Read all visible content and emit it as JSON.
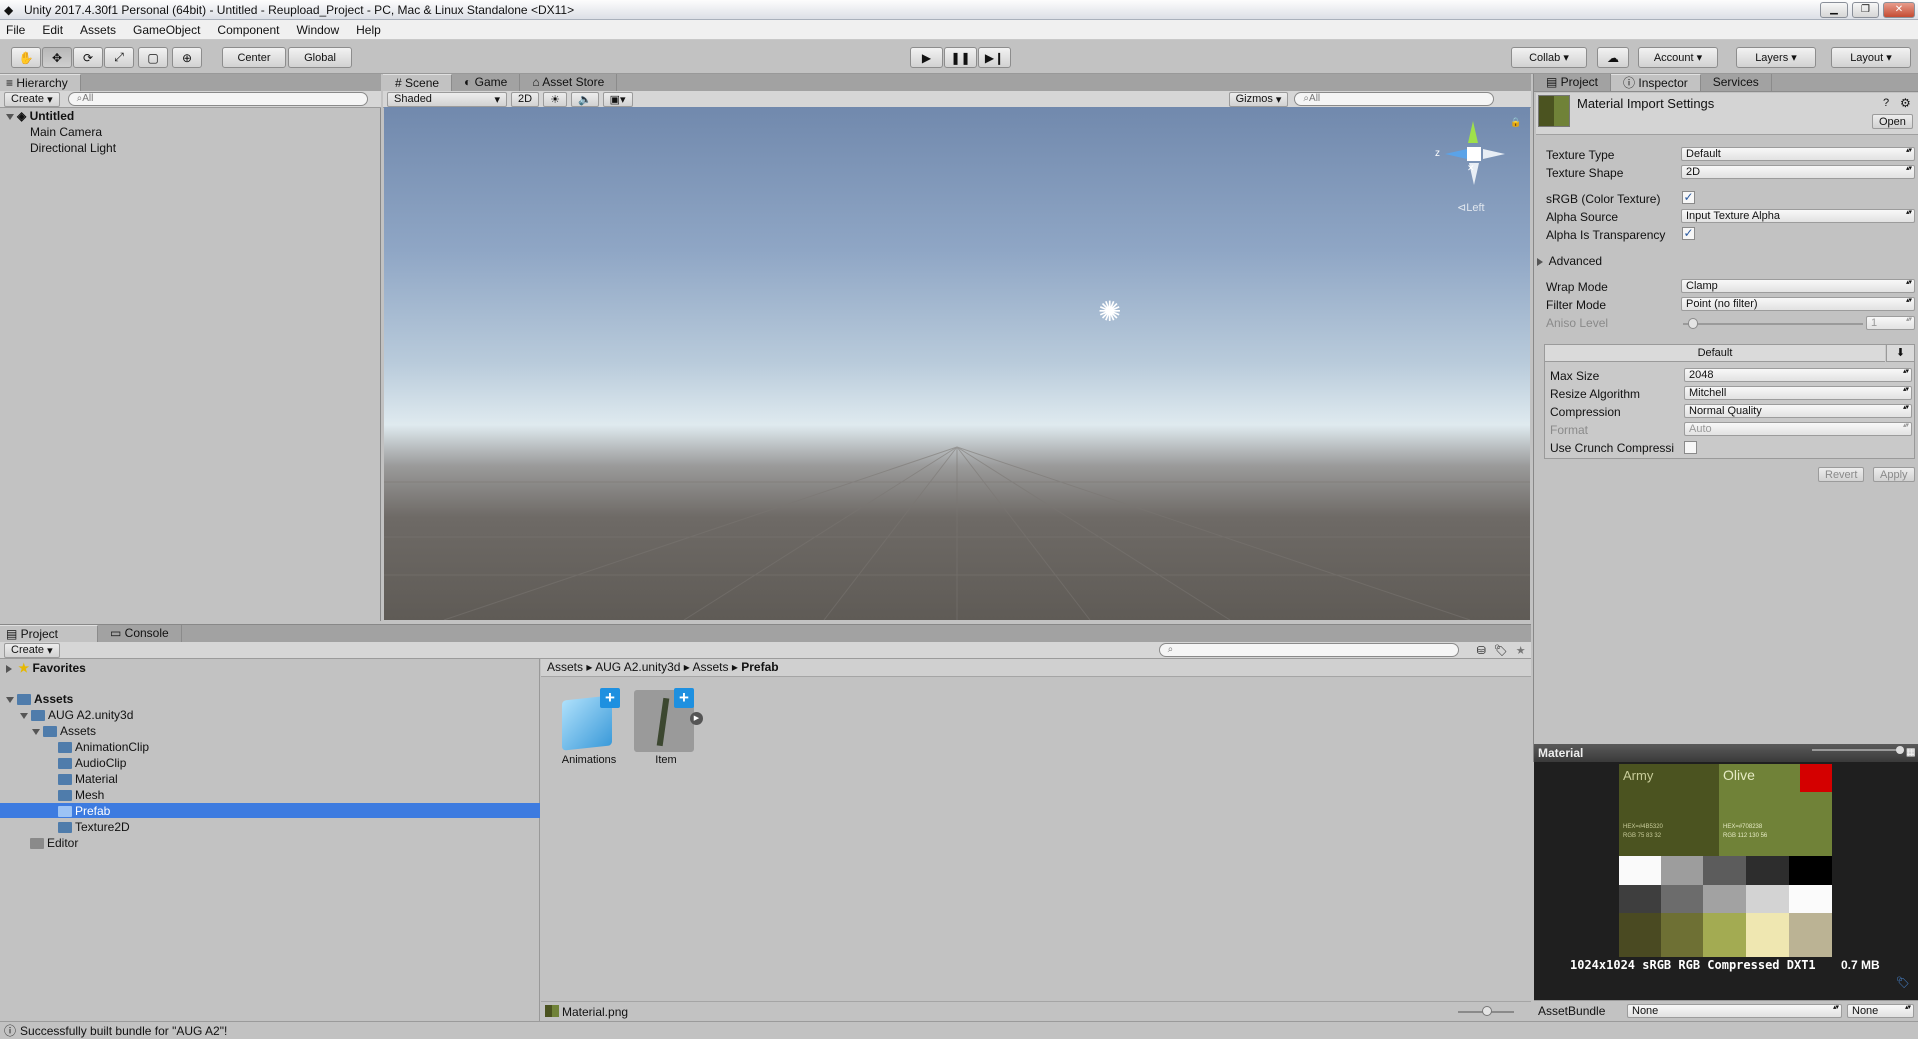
{
  "window": {
    "title": "Unity 2017.4.30f1 Personal (64bit) - Untitled - Reupload_Project - PC, Mac & Linux Standalone <DX11>"
  },
  "menu": [
    "File",
    "Edit",
    "Assets",
    "GameObject",
    "Component",
    "Window",
    "Help"
  ],
  "toolbar": {
    "pivot": "Center",
    "space": "Global",
    "collab": "Collab",
    "account": "Account",
    "layers": "Layers",
    "layout": "Layout"
  },
  "hierarchy": {
    "tab": "Hierarchy",
    "create": "Create",
    "search_placeholder": "All",
    "scene": "Untitled",
    "items": [
      "Main Camera",
      "Directional Light"
    ]
  },
  "scene_tabs": {
    "scene": "Scene",
    "game": "Game",
    "asset_store": "Asset Store",
    "shading": "Shaded",
    "mode_2d": "2D",
    "gizmos": "Gizmos",
    "search_placeholder": "All",
    "gizmo_label": "Left",
    "gizmo_z": "z"
  },
  "inspector": {
    "tabs": [
      "Project",
      "Inspector",
      "Services"
    ],
    "title": "Material Import Settings",
    "open": "Open",
    "texture_type_label": "Texture Type",
    "texture_type": "Default",
    "texture_shape_label": "Texture Shape",
    "texture_shape": "2D",
    "srgb_label": "sRGB (Color Texture)",
    "alpha_source_label": "Alpha Source",
    "alpha_source": "Input Texture Alpha",
    "alpha_transparency_label": "Alpha Is Transparency",
    "advanced": "Advanced",
    "wrap_mode_label": "Wrap Mode",
    "wrap_mode": "Clamp",
    "filter_mode_label": "Filter Mode",
    "filter_mode": "Point (no filter)",
    "aniso_label": "Aniso Level",
    "aniso_value": "1",
    "platform_tab": "Default",
    "max_size_label": "Max Size",
    "max_size": "2048",
    "resize_label": "Resize Algorithm",
    "resize": "Mitchell",
    "compression_label": "Compression",
    "compression": "Normal Quality",
    "format_label": "Format",
    "format": "Auto",
    "crunch_label": "Use Crunch Compressi",
    "revert": "Revert",
    "apply": "Apply"
  },
  "preview": {
    "header": "Material",
    "swatch_army": "Army",
    "swatch_olive": "Olive",
    "army_hex": "HEX=#4B5320",
    "army_rgb": "RGB 75 83 32",
    "olive_hex": "HEX=#708238",
    "olive_rgb": "RGB 112 130 56",
    "info": "1024x1024 sRGB  RGB Compressed DXT1",
    "size": "0.7 MB",
    "assetbundle_label": "AssetBundle",
    "assetbundle_value": "None",
    "variant_value": "None"
  },
  "project": {
    "tabs": [
      "Project",
      "Console"
    ],
    "create": "Create",
    "favorites": "Favorites",
    "assets_root": "Assets",
    "tree": [
      {
        "label": "AUG A2.unity3d",
        "depth": 1
      },
      {
        "label": "Assets",
        "depth": 2
      },
      {
        "label": "AnimationClip",
        "depth": 3
      },
      {
        "label": "AudioClip",
        "depth": 3
      },
      {
        "label": "Material",
        "depth": 3
      },
      {
        "label": "Mesh",
        "depth": 3
      },
      {
        "label": "Prefab",
        "depth": 3,
        "selected": true
      },
      {
        "label": "Texture2D",
        "depth": 3
      },
      {
        "label": "Editor",
        "depth": 1
      }
    ],
    "breadcrumb": [
      "Assets",
      "AUG A2.unity3d",
      "Assets",
      "Prefab"
    ],
    "grid_items": [
      "Animations",
      "Item"
    ],
    "footer_file": "Material.png"
  },
  "status": {
    "message": "Successfully built bundle for \"AUG A2\"!"
  },
  "colors": {
    "army": "#4B5320",
    "olive": "#708238",
    "selection": "#3d7be0",
    "red": "#d40000"
  }
}
